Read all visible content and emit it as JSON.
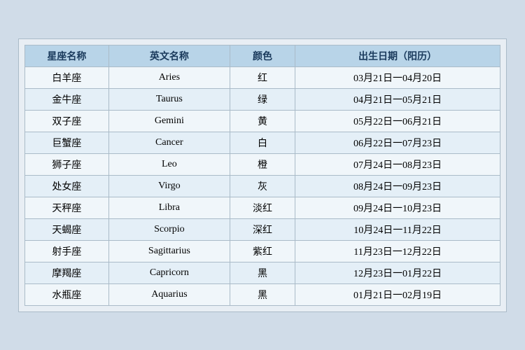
{
  "table": {
    "headers": {
      "zh_name": "星座名称",
      "en_name": "英文名称",
      "color": "颜色",
      "birthday": "出生日期（阳历）"
    },
    "rows": [
      {
        "zh": "白羊座",
        "en": "Aries",
        "color": "红",
        "date": "03月21日一04月20日"
      },
      {
        "zh": "金牛座",
        "en": "Taurus",
        "color": "绿",
        "date": "04月21日一05月21日"
      },
      {
        "zh": "双子座",
        "en": "Gemini",
        "color": "黄",
        "date": "05月22日一06月21日"
      },
      {
        "zh": "巨蟹座",
        "en": "Cancer",
        "color": "白",
        "date": "06月22日一07月23日"
      },
      {
        "zh": "狮子座",
        "en": "Leo",
        "color": "橙",
        "date": "07月24日一08月23日"
      },
      {
        "zh": "处女座",
        "en": "Virgo",
        "color": "灰",
        "date": "08月24日一09月23日"
      },
      {
        "zh": "天秤座",
        "en": "Libra",
        "color": "淡红",
        "date": "09月24日一10月23日"
      },
      {
        "zh": "天蝎座",
        "en": "Scorpio",
        "color": "深红",
        "date": "10月24日一11月22日"
      },
      {
        "zh": "射手座",
        "en": "Sagittarius",
        "color": "紫红",
        "date": "11月23日一12月22日"
      },
      {
        "zh": "摩羯座",
        "en": "Capricorn",
        "color": "黑",
        "date": "12月23日一01月22日"
      },
      {
        "zh": "水瓶座",
        "en": "Aquarius",
        "color": "黑",
        "date": "01月21日一02月19日"
      }
    ]
  }
}
